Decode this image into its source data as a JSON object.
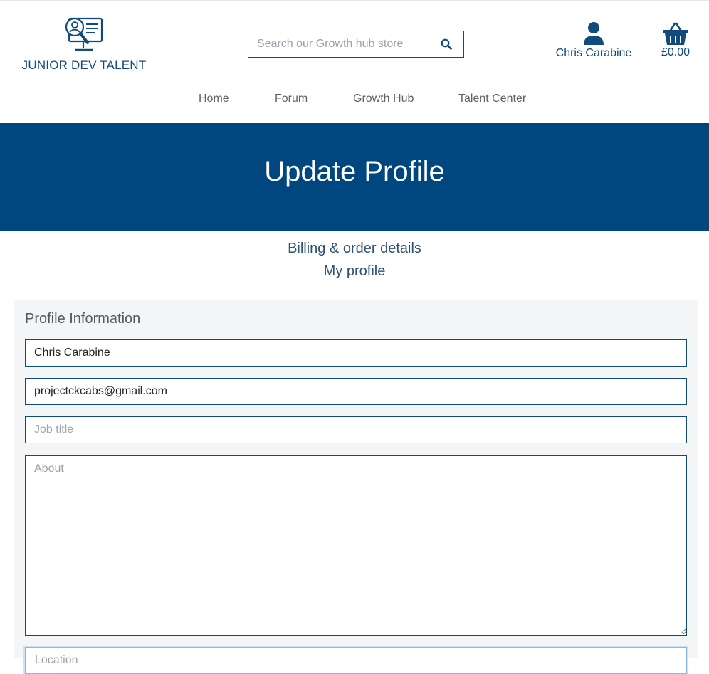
{
  "brand": {
    "name": "JUNIOR DEV TALENT",
    "logo_icon": "monitor-magnifier-person-icon",
    "color": "#124a7d"
  },
  "search": {
    "placeholder": "Search our Growth hub store",
    "icon": "search-icon"
  },
  "account": {
    "name": "Chris Carabine",
    "icon": "user-icon"
  },
  "basket": {
    "total": "£0.00",
    "icon": "basket-icon"
  },
  "nav": {
    "items": [
      {
        "label": "Home"
      },
      {
        "label": "Forum"
      },
      {
        "label": "Growth Hub"
      },
      {
        "label": "Talent Center"
      }
    ]
  },
  "banner": {
    "title": "Update Profile",
    "background": "#00467f"
  },
  "sublinks": [
    {
      "label": "Billing & order details"
    },
    {
      "label": "My profile"
    }
  ],
  "profile_form": {
    "title": "Profile Information",
    "name_value": "Chris Carabine",
    "email_value": "projectckcabs@gmail.com",
    "job_title_placeholder": "Job title",
    "about_placeholder": "About",
    "location_placeholder": "Location"
  }
}
